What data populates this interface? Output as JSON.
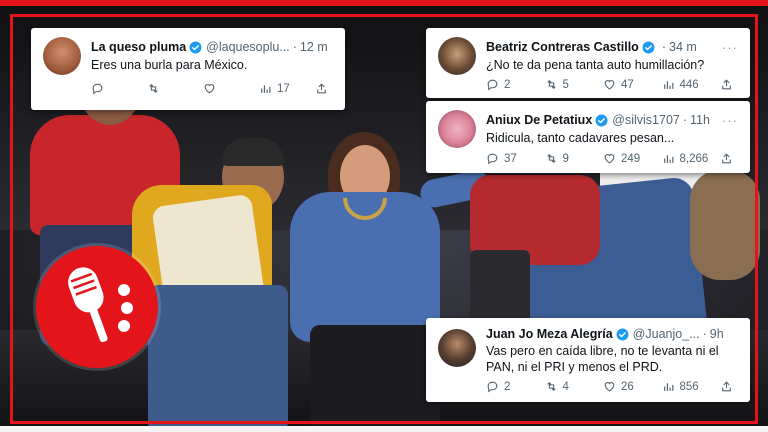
{
  "colors": {
    "accent_red": "#e3151b",
    "verified_blue": "#1d9bf0",
    "muted": "#536471",
    "jacket_red": "#c8262a",
    "vest_yellow": "#e0a81e",
    "dress_blue": "#4a6fb0",
    "jeans_blue": "#3e5b8c"
  },
  "logo_icon": "microphone-icon",
  "tweets": [
    {
      "name": "La queso pluma",
      "handle": "@laquesoplu...",
      "time": "12 m",
      "more": "···",
      "text": "Eres una burla para México.",
      "replies": "",
      "retweets": "",
      "likes": "",
      "views": "17"
    },
    {
      "name": "Beatriz Contreras Castillo",
      "handle": "",
      "time": "34 m",
      "more": "···",
      "text": "¿No te da pena tanta auto humillación?",
      "replies": "2",
      "retweets": "5",
      "likes": "47",
      "views": "446"
    },
    {
      "name": "Aniux De Petatiux",
      "handle": "@silvis1707",
      "time": "11h",
      "more": "···",
      "text": "Ridicula, tanto cadavares pesan...",
      "replies": "37",
      "retweets": "9",
      "likes": "249",
      "views": "8,266"
    },
    {
      "name": "Juan Jo Meza Alegría",
      "handle": "@Juanjo_...",
      "time": "9h",
      "more": "···",
      "text": "Vas pero en caída libre, no te levanta ni el PAN, ni el PRI y menos el PRD.",
      "replies": "2",
      "retweets": "4",
      "likes": "26",
      "views": "856"
    }
  ]
}
